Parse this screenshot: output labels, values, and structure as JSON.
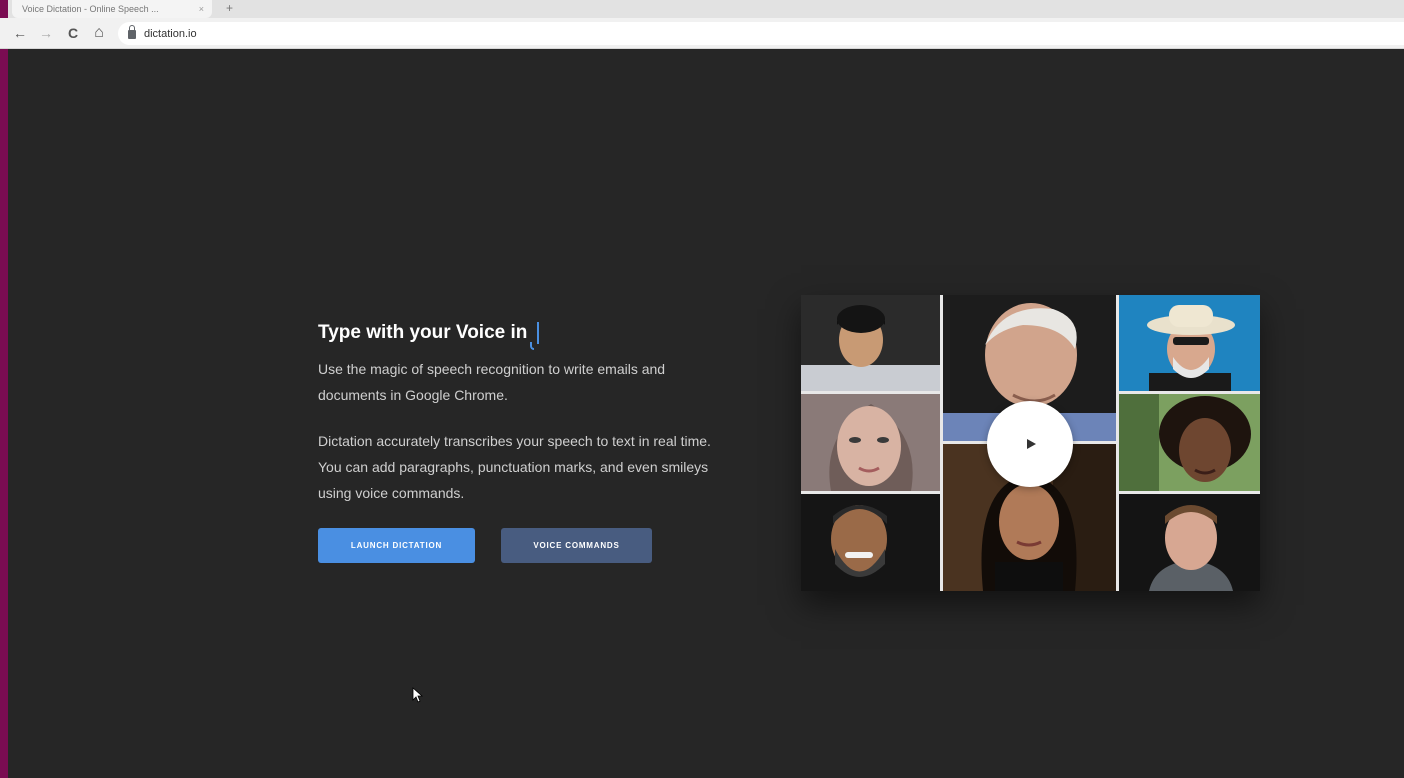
{
  "browser": {
    "tab_title": "Voice Dictation - Online Speech ...",
    "tab_close": "×",
    "new_tab": "+",
    "back": "←",
    "forward": "→",
    "reload": "C",
    "home": "⌂",
    "url": "dictation.io"
  },
  "hero": {
    "headline": "Type with your Voice in",
    "intro": "Use the magic of speech recognition to write emails and documents in Google Chrome.",
    "description": "Dictation accurately transcribes your speech to text in real time. You can add paragraphs, punctuation marks, and even smileys using voice commands.",
    "launch_button": "LAUNCH DICTATION",
    "commands_button": "VOICE COMMANDS"
  },
  "video": {
    "play_icon": "play-icon"
  },
  "colors": {
    "page_bg": "#262626",
    "primary_button": "#4a8fe2",
    "secondary_button": "#485c80",
    "frame": "#7a0c52"
  }
}
